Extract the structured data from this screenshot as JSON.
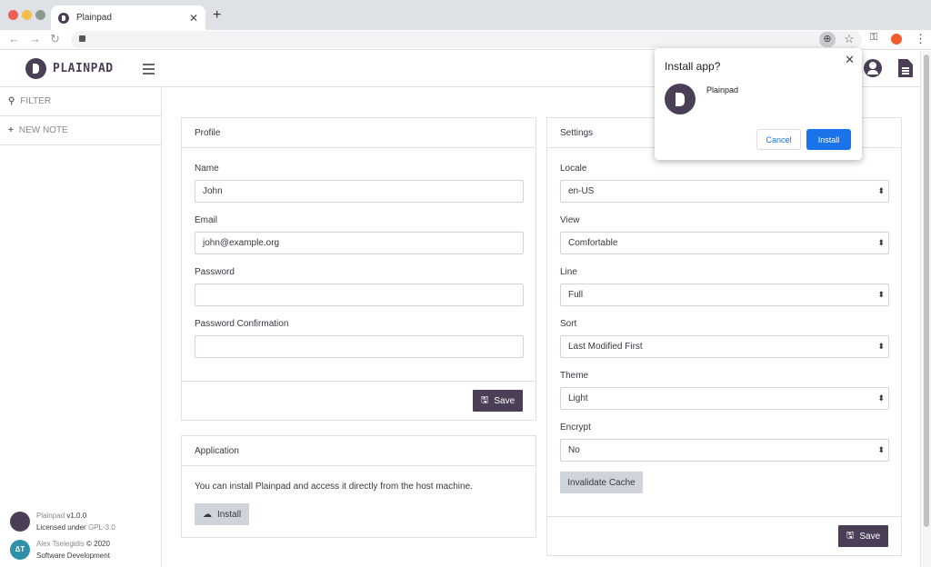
{
  "browser": {
    "tab_title": "Plainpad",
    "tab_close": "✕",
    "new_tab": "+",
    "back": "←",
    "forward": "→",
    "reload": "↻",
    "install_icon": "⊕",
    "star_icon": "☆",
    "key_icon": "⚿",
    "menu_icon": "⋮",
    "traffic_colors": [
      "#ee5f57",
      "#f5bd4f",
      "#8d9a8c"
    ]
  },
  "header": {
    "brand": "PLAINPAD"
  },
  "sidebar": {
    "items": [
      {
        "icon": "search-icon",
        "glyph": "⚲",
        "label": "FILTER"
      },
      {
        "icon": "plus-icon",
        "glyph": "+",
        "label": "NEW NOTE"
      }
    ],
    "footer": {
      "app_name": "Plainpad",
      "version": "v1.0.0",
      "license_prefix": "Licensed under",
      "license": "GPL-3.0",
      "author": "Alex Tselegidis",
      "copyright": "© 2020",
      "company": "Software Development",
      "author_initials": "ΔT"
    }
  },
  "profile": {
    "title": "Profile",
    "fields": [
      {
        "label": "Name",
        "value": "John"
      },
      {
        "label": "Email",
        "value": "john@example.org"
      },
      {
        "label": "Password",
        "value": ""
      },
      {
        "label": "Password Confirmation",
        "value": ""
      }
    ],
    "save_label": "Save"
  },
  "application": {
    "title": "Application",
    "text": "You can install Plainpad and access it directly from the host machine.",
    "install_label": "Install"
  },
  "settings": {
    "title": "Settings",
    "fields": [
      {
        "label": "Locale",
        "value": "en-US"
      },
      {
        "label": "View",
        "value": "Comfortable"
      },
      {
        "label": "Line",
        "value": "Full"
      },
      {
        "label": "Sort",
        "value": "Last Modified First"
      },
      {
        "label": "Theme",
        "value": "Light"
      },
      {
        "label": "Encrypt",
        "value": "No"
      }
    ],
    "invalidate_label": "Invalidate Cache",
    "save_label": "Save"
  },
  "install_popup": {
    "title": "Install app?",
    "app_name": "Plainpad",
    "cancel_label": "Cancel",
    "install_label": "Install",
    "close": "✕"
  },
  "colors": {
    "brand": "#4b3f57",
    "chrome_blue": "#1a73e8",
    "light_button": "#ced4da"
  }
}
